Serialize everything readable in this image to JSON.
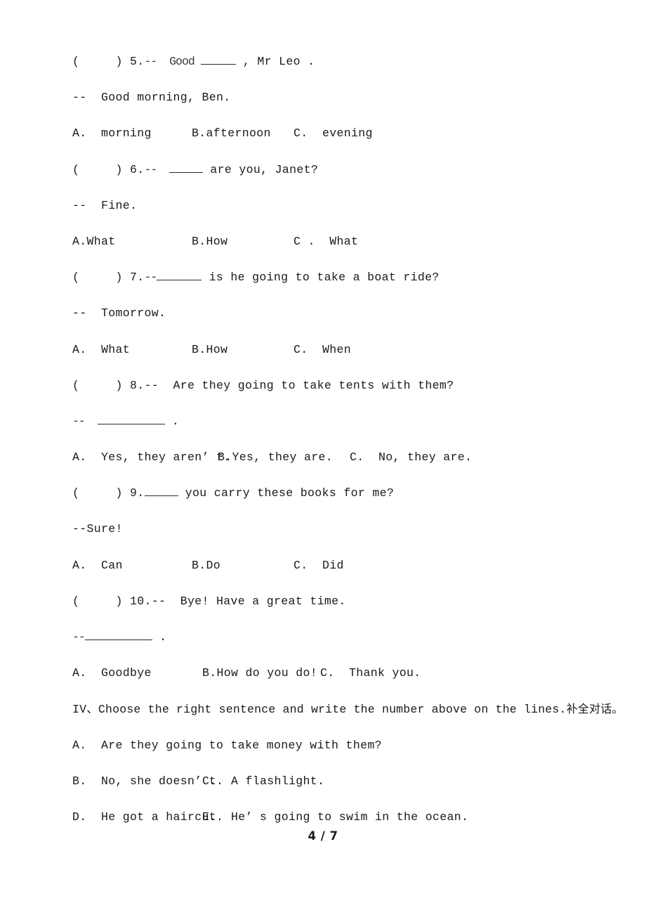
{
  "document": {
    "page_label": "4 / 7",
    "page_number": 4,
    "total_pages": 7
  },
  "questions": [
    {
      "marker": "(     ) 5.",
      "prompt_prefix": "--  Good ",
      "prompt_suffix": " , Mr Leo .",
      "answer_line": "--  Good morning, Ben.",
      "options": {
        "a": "A.  morning",
        "b": "B.afternoon",
        "c": "C.  evening"
      }
    },
    {
      "marker": "(     ) 6.",
      "prompt_prefix": "--  ",
      "prompt_suffix": " are you, Janet?",
      "answer_line": "--  Fine.",
      "options": {
        "a": "A.What",
        "b": "B.How",
        "c": "C .  What"
      }
    },
    {
      "marker": "(     ) 7.",
      "prompt_prefix": "--",
      "prompt_suffix": " is he going to take a boat ride?",
      "answer_line": "--  Tomorrow.",
      "options": {
        "a": "A.  What",
        "b": "B.How",
        "c": "C.  When"
      }
    },
    {
      "marker": "(     ) 8.",
      "prompt_text": "--  Are they going to take tents with them?",
      "answer_prefix": "--  ",
      "answer_suffix": " .",
      "options": {
        "a": "A.  Yes, they aren’ t.",
        "b": "B.Yes, they are.",
        "c": "C.  No, they are."
      }
    },
    {
      "marker": "(     ) 9.",
      "prompt_prefix": "",
      "prompt_suffix": " you carry these books for me?",
      "answer_line": "--Sure!",
      "options": {
        "a": "A.  Can",
        "b": "B.Do",
        "c": "C.  Did"
      }
    },
    {
      "marker": "(     ) 10.",
      "prompt_text": "--  Bye! Have a great time.",
      "answer_prefix": "--",
      "answer_suffix": " .",
      "options": {
        "a": "A.  Goodbye",
        "b": "B.How do you do!",
        "c": "C.  Thank you."
      }
    }
  ],
  "section_iv": {
    "heading_latin": "IV、Choose the right sentence and write the number above on the lines.",
    "heading_cjk": "补全对话。",
    "choices": [
      {
        "row": 1,
        "left": "A.  Are they going to take money with them?",
        "right": ""
      },
      {
        "row": 2,
        "left": "B.  No, she doesn’ t.",
        "right": "C.  A flashlight."
      },
      {
        "row": 3,
        "left": "D.  He got a haircut.",
        "right": "E.  He’ s going to swim in the ocean."
      }
    ]
  }
}
